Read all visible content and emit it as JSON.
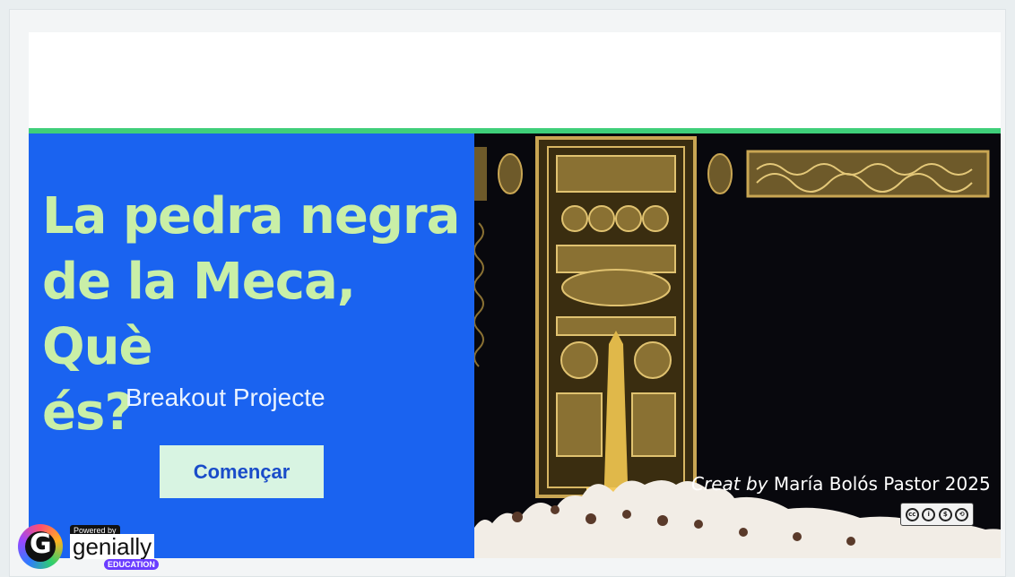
{
  "slide": {
    "title_lines": [
      "La pedra negra",
      "de la Meca, Què",
      "és?"
    ],
    "subtitle": "Breakout Projecte",
    "start_button": "Començar",
    "credit_prefix": "Creat by",
    "credit_author": "María Bolós Pastor 2025",
    "license_icon": "cc-by-nc-sa-icon",
    "photo": "kaaba-door-image"
  },
  "branding": {
    "powered_by": "Powered by",
    "name": "genially",
    "edition": "EDUCATION",
    "logo_icon": "genially-logo-icon"
  },
  "colors": {
    "panel_blue": "#1a63f0",
    "title_green": "#c9efa7",
    "accent_line": "#3fcf7a",
    "button_bg": "#d8f4e2"
  }
}
